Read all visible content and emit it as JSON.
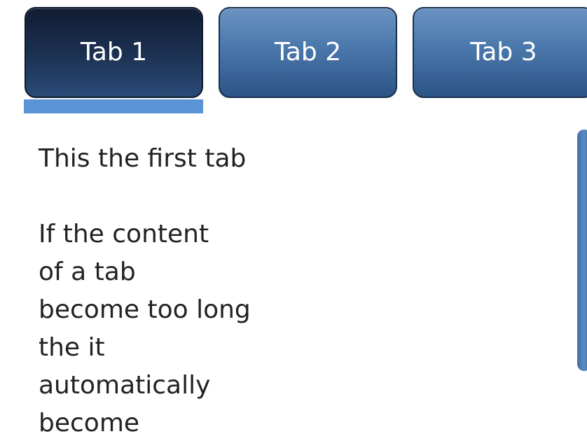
{
  "tabs": [
    {
      "label": "Tab 1",
      "active": true
    },
    {
      "label": "Tab 2",
      "active": false
    },
    {
      "label": "Tab 3",
      "active": false
    }
  ],
  "content": {
    "heading": "This the first tab",
    "lines": [
      "If the content",
      "of a tab",
      "become too long",
      "the it",
      "automatically",
      "become"
    ]
  },
  "colors": {
    "active_tab": "#1b3050",
    "inactive_tab": "#4a77ab",
    "indicator": "#5b94d6",
    "scrollbar": "#4a7db5"
  }
}
